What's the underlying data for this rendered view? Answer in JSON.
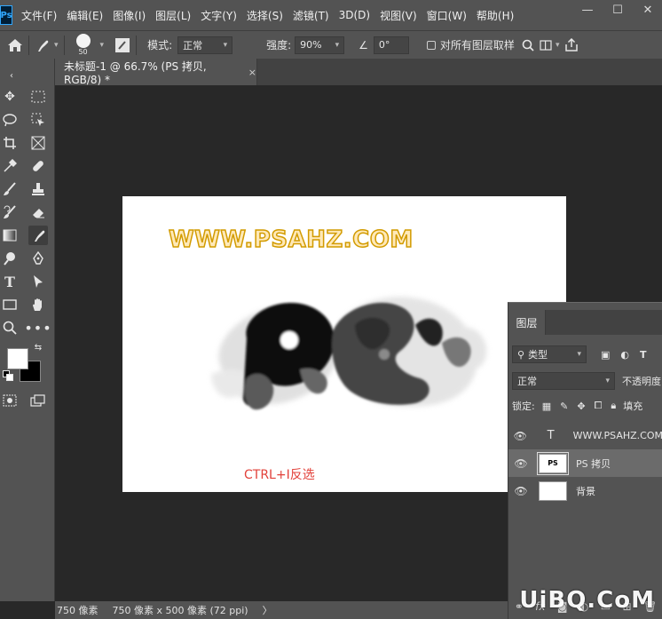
{
  "menubar": {
    "logo": "Ps",
    "items": [
      "文件(F)",
      "编辑(E)",
      "图像(I)",
      "图层(L)",
      "文字(Y)",
      "选择(S)",
      "滤镜(T)",
      "3D(D)",
      "视图(V)",
      "窗口(W)",
      "帮助(H)"
    ],
    "window_controls": [
      "—",
      "☐",
      "✕"
    ]
  },
  "options": {
    "brush_size": "50",
    "mode_label": "模式:",
    "mode_value": "正常",
    "strength_label": "强度:",
    "strength_value": "90%",
    "angle_value": "0°",
    "sample_all_label": "对所有图层取样"
  },
  "document_tab": {
    "title": "未标题-1 @ 66.7% (PS 拷贝, RGB/8) *",
    "close": "×"
  },
  "canvas": {
    "watermark_text": "WWW.PSAHZ.COM",
    "hint_text": "CTRL+I反选"
  },
  "status": {
    "left_value": "750 像素",
    "doc_size": "750 像素 x 500 像素 (72 ppi)",
    "arrow": "〉"
  },
  "layers_panel": {
    "tab_label": "图层",
    "filter_label": "类型",
    "blend_mode": "正常",
    "opacity_label": "不透明度",
    "lock_label": "锁定:",
    "fill_label": "填充",
    "layers": [
      {
        "name": "WWW.PSAHZ.COM",
        "kind": "text",
        "selected": false
      },
      {
        "name": "PS 拷贝",
        "kind": "image",
        "thumb": "PS",
        "selected": true
      },
      {
        "name": "背景",
        "kind": "image",
        "thumb": "",
        "selected": false
      }
    ]
  },
  "site_watermark": "UiBQ.CoM"
}
